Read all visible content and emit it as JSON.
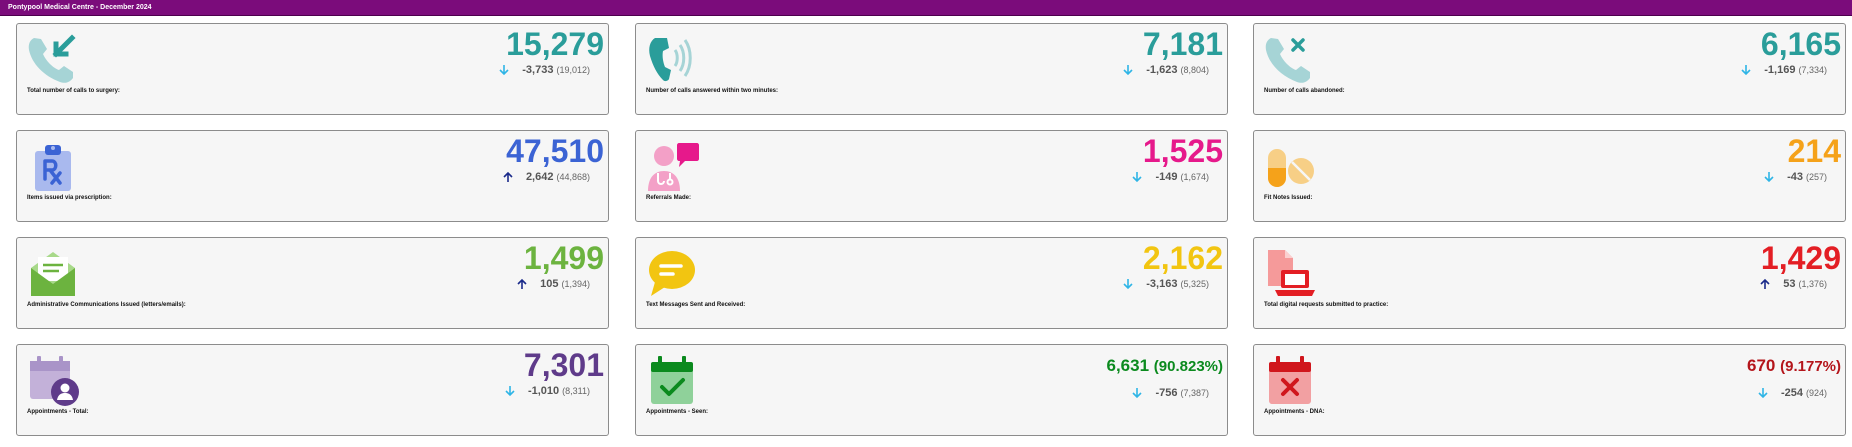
{
  "header": {
    "title": "Pontypool Medical Centre - December 2024"
  },
  "colors": {
    "teal": "#2a9d9a",
    "teal_light": "#a6d4d6",
    "blue": "#3b63d4",
    "pink": "#e6198b",
    "orange": "#f5a21a",
    "green": "#6cb33f",
    "yellow": "#f2c511",
    "red": "#e31e24",
    "purple": "#5f3b8a",
    "dark_green": "#0b8a1e",
    "dark_red": "#b4151b",
    "arrow_down": "#2fb5e6",
    "arrow_up": "#1a2a8a"
  },
  "cards": [
    {
      "label": "Total number of calls to surgery:",
      "value": "15,279",
      "delta": "-3,733",
      "prev": "(19,012)",
      "trend": "down",
      "icon": "phone-incoming-icon"
    },
    {
      "label": "Number of calls answered within two minutes:",
      "value": "7,181",
      "delta": "-1,623",
      "prev": "(8,804)",
      "trend": "down",
      "icon": "phone-ringing-icon"
    },
    {
      "label": "Number of calls abandoned:",
      "value": "6,165",
      "delta": "-1,169",
      "prev": "(7,334)",
      "trend": "down",
      "icon": "phone-missed-icon"
    },
    {
      "label": "Items issued via prescription:",
      "value": "47,510",
      "delta": "2,642",
      "prev": "(44,868)",
      "trend": "up",
      "icon": "prescription-clipboard-icon"
    },
    {
      "label": "Referrals Made:",
      "value": "1,525",
      "delta": "-149",
      "prev": "(1,674)",
      "trend": "down",
      "icon": "doctor-chat-icon"
    },
    {
      "label": "Fit Notes Issued:",
      "value": "214",
      "delta": "-43",
      "prev": "(257)",
      "trend": "down",
      "icon": "pills-icon"
    },
    {
      "label": "Administrative Communications Issued (letters/emails):",
      "value": "1,499",
      "delta": "105",
      "prev": "(1,394)",
      "trend": "up",
      "icon": "envelope-open-icon"
    },
    {
      "label": "Text Messages Sent and Received:",
      "value": "2,162",
      "delta": "-3,163",
      "prev": "(5,325)",
      "trend": "down",
      "icon": "chat-bubble-icon"
    },
    {
      "label": "Total digital requests submitted to practice:",
      "value": "1,429",
      "delta": "53",
      "prev": "(1,376)",
      "trend": "up",
      "icon": "laptop-document-icon"
    },
    {
      "label": "Appointments - Total:",
      "value": "7,301",
      "delta": "-1,010",
      "prev": "(8,311)",
      "trend": "down",
      "icon": "calendar-user-icon"
    },
    {
      "label": "Appointments - Seen:",
      "value": "6,631",
      "pct": "(90.823%)",
      "delta": "-756",
      "prev": "(7,387)",
      "trend": "down",
      "icon": "calendar-check-icon"
    },
    {
      "label": "Appointments - DNA:",
      "value": "670",
      "pct": "(9.177%)",
      "delta": "-254",
      "prev": "(924)",
      "trend": "down",
      "icon": "calendar-cross-icon"
    }
  ]
}
